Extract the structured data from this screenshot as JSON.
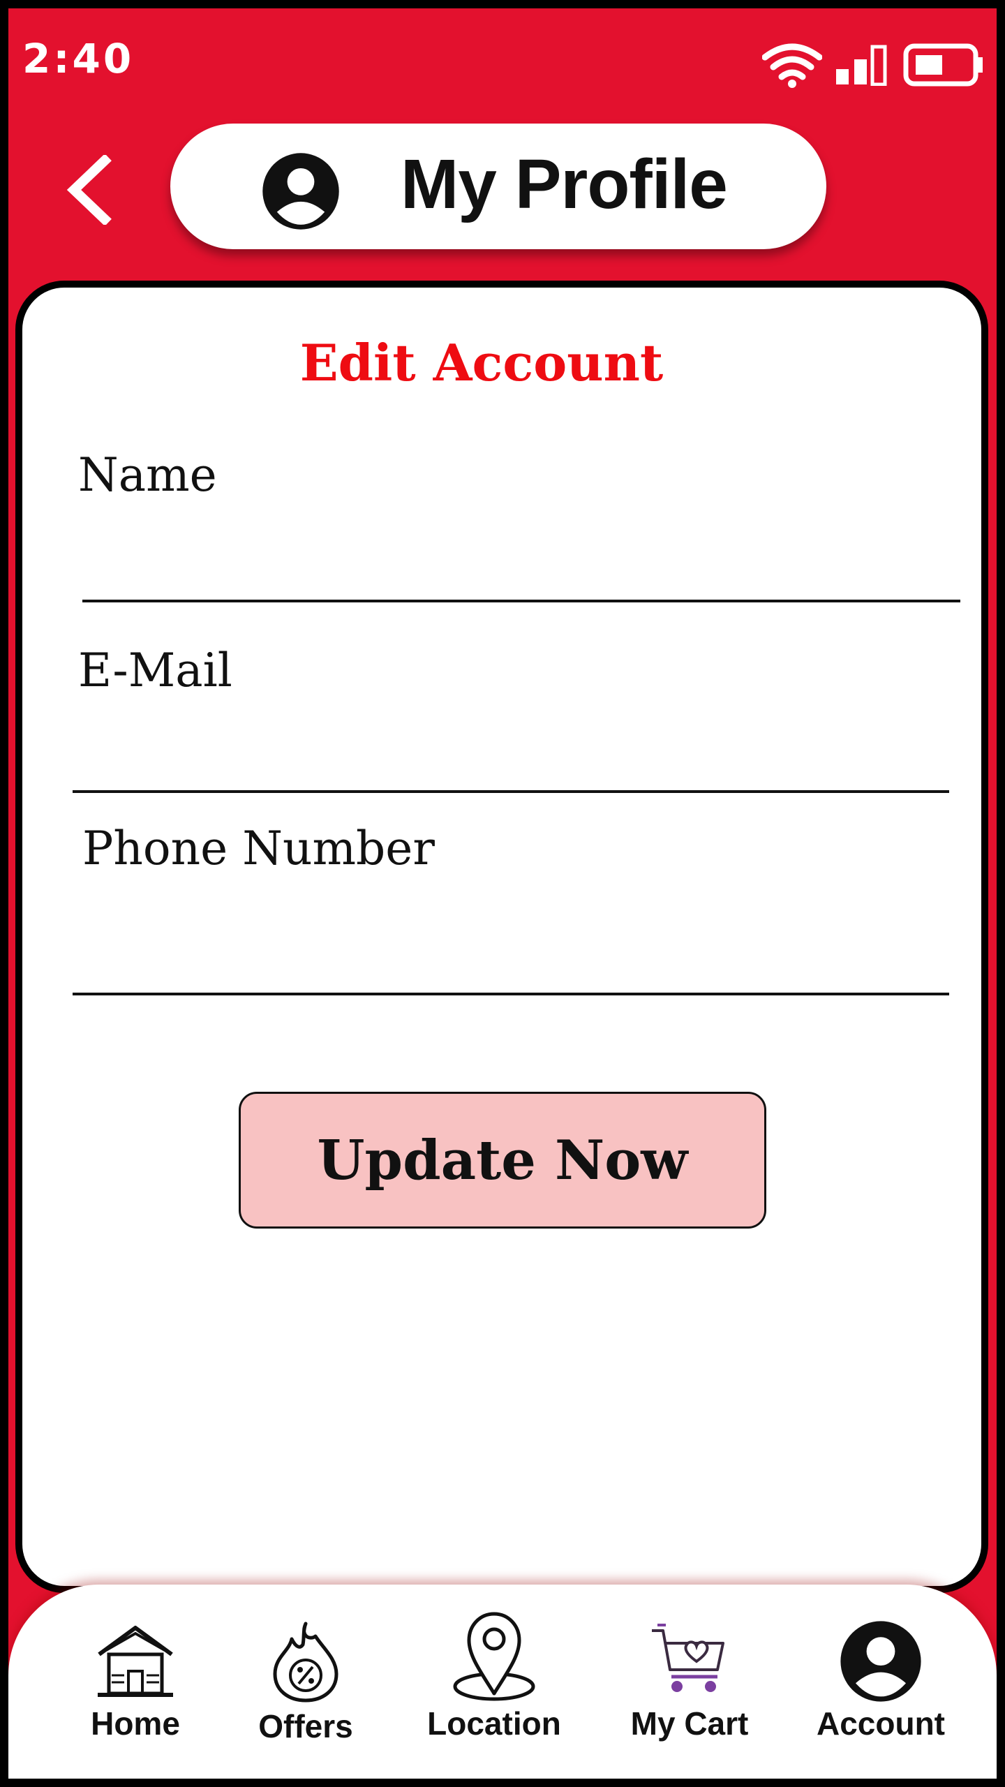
{
  "status_bar": {
    "time": "2:40",
    "icons": [
      "wifi-icon",
      "signal-icon",
      "battery-icon"
    ]
  },
  "header": {
    "title": "My Profile",
    "back_icon": "chevron-left-icon",
    "avatar_icon": "account-circle-icon"
  },
  "form": {
    "title": "Edit Account",
    "fields": [
      {
        "label": "Name",
        "value": ""
      },
      {
        "label": "E-Mail",
        "value": ""
      },
      {
        "label": "Phone Number",
        "value": ""
      }
    ],
    "submit_label": "Update Now"
  },
  "bottom_nav": {
    "items": [
      {
        "label": "Home",
        "icon": "house-icon"
      },
      {
        "label": "Offers",
        "icon": "discount-flame-icon"
      },
      {
        "label": "Location",
        "icon": "map-pin-icon"
      },
      {
        "label": "My Cart",
        "icon": "cart-heart-icon"
      },
      {
        "label": "Account",
        "icon": "account-circle-icon"
      }
    ]
  },
  "colors": {
    "primary": "#e3112e",
    "title_red": "#ee0c12",
    "button_bg": "#f8c2c2",
    "cart_accent": "#7b3fa0"
  }
}
